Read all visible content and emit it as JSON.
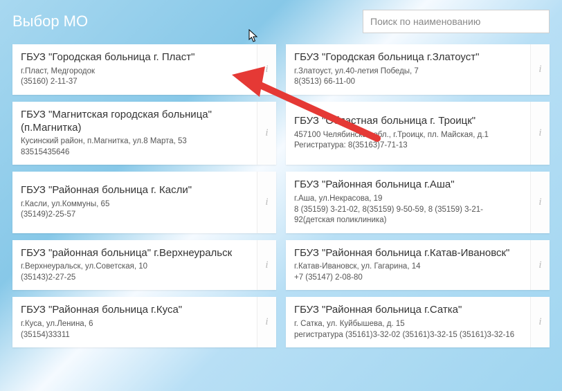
{
  "page_title": "Выбор МО",
  "search_placeholder": "Поиск по наименованию",
  "info_symbol": "i",
  "cards": [
    {
      "title": "ГБУЗ \"Городская больница г. Пласт\"",
      "line1": "г.Пласт, Медгородок",
      "line2": "(35160) 2-11-37",
      "line3": ""
    },
    {
      "title": "ГБУЗ \"Городская больница г.Златоуст\"",
      "line1": "г.Златоуст, ул.40-летия Победы, 7",
      "line2": "8(3513) 66-11-00",
      "line3": ""
    },
    {
      "title": "ГБУЗ \"Магнитская городская больница\" (п.Магнитка)",
      "line1": "Кусинский район, п.Магнитка, ул.8 Марта, 53",
      "line2": "83515435646",
      "line3": ""
    },
    {
      "title": "ГБУЗ \"Областная больница г. Троицк\"",
      "line1": "457100 Челябинская обл., г.Троицк, пл. Майская, д.1",
      "line2": "Регистратура: 8(35163)7-71-13",
      "line3": ""
    },
    {
      "title": "ГБУЗ \"Районная больница г. Касли\"",
      "line1": "г.Касли, ул.Коммуны, 65",
      "line2": "(35149)2-25-57",
      "line3": ""
    },
    {
      "title": "ГБУЗ \"Районная больница г.Аша\"",
      "line1": "г.Аша, ул.Некрасова, 19",
      "line2": "8 (35159) 3-21-02, 8(35159) 9-50-59, 8 (35159) 3-21-92(детская поликлиника)",
      "line3": ""
    },
    {
      "title": "ГБУЗ \"районная больница\" г.Верхнеуральск",
      "line1": "г.Верхнеуральск, ул.Советская, 10",
      "line2": "(35143)2-27-25",
      "line3": ""
    },
    {
      "title": "ГБУЗ \"Районная больница г.Катав-Ивановск\"",
      "line1": "г.Катав-Ивановск, ул. Гагарина, 14",
      "line2": "+7 (35147) 2-08-80",
      "line3": ""
    },
    {
      "title": "ГБУЗ \"Районная больница г.Куса\"",
      "line1": "г.Куса, ул.Ленина, 6",
      "line2": "(35154)33311",
      "line3": ""
    },
    {
      "title": "ГБУЗ \"Районная больница г.Сатка\"",
      "line1": "г. Сатка, ул. Куйбышева, д. 15",
      "line2": "регистратура (35161)3-32-02 (35161)3-32-15 (35161)3-32-16",
      "line3": ""
    }
  ]
}
